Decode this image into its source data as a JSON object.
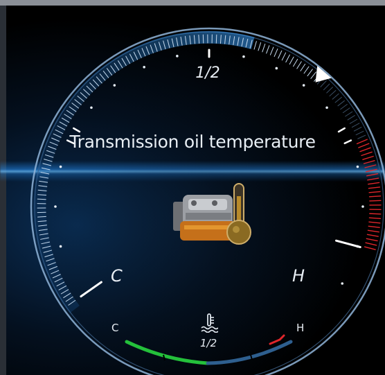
{
  "gauge": {
    "title": "Transmission oil temperature",
    "scale_mid_label": "1/2",
    "scale_cold_label": "C",
    "scale_hot_label": "H",
    "needle_level": 0.72
  },
  "mini_gauge": {
    "cold_label": "C",
    "hot_label": "H",
    "mid_label": "1/2",
    "icon": "coolant-temperature-icon"
  },
  "center_icon": "transmission-thermometer-icon",
  "colors": {
    "arc_blue": "#2e8fe6",
    "hot_zone": "#e0262b",
    "cold_green": "#24c03b",
    "ring": "#a9c6e0"
  }
}
